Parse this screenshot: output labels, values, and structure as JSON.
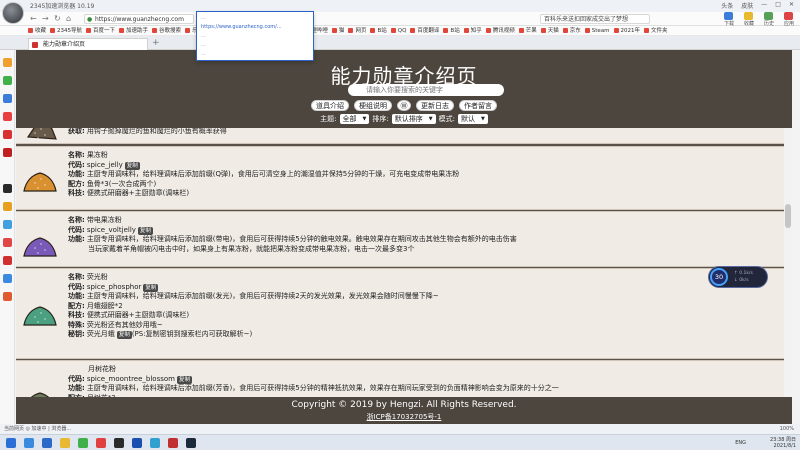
{
  "browser": {
    "title": "2345加速浏览器 10.19",
    "window_controls": [
      "头条",
      "皮肤",
      "—",
      "□",
      "✕"
    ],
    "url": "https://www.guanzhecng.com",
    "search_placeholder": "百科乐来送扣回家成交出了梦想",
    "top_icons": [
      {
        "name": "download-icon",
        "label": "下载",
        "color": "#3b7dd8"
      },
      {
        "name": "favorites-icon",
        "label": "收藏",
        "color": "#e8b830"
      },
      {
        "name": "history-icon",
        "label": "历史",
        "color": "#57a05a"
      },
      {
        "name": "extensions-icon",
        "label": "应用",
        "color": "#d44"
      }
    ],
    "bookmarks": [
      "收藏",
      "2345导航",
      "百度一下",
      "加速助手",
      "谷歌搜索",
      "乐视",
      "网易",
      "Minecraft",
      "正在播放",
      "哔哩哔哩",
      "猫",
      "网页",
      "B站",
      "QQ",
      "百度翻译",
      "B站",
      "知乎",
      "腾讯视频",
      "芒果",
      "天猫",
      "京东",
      "Steam",
      "2021年",
      "文件夹"
    ],
    "tab_title": "能力勋章介绍页",
    "dropdown_lines": [
      "...",
      "https://www.guanzhecng.com/...",
      "...",
      "...",
      "..."
    ]
  },
  "page": {
    "title": "能力勋章介绍页",
    "search_placeholder": "请输入你要搜索的关键字",
    "buttons": [
      "道具介绍",
      "梗组说明",
      "Ⓦ",
      "更新日志",
      "作者留言"
    ],
    "filters": {
      "theme_label": "主题:",
      "theme_value": "全部",
      "sort_label": "排序:",
      "sort_value": "默认排序",
      "mode_label": "模式:",
      "mode_value": "默认"
    },
    "items": [
      {
        "rows": [
          {
            "k": "获取:",
            "v": "用钩子抛掉魔烂的鱼和魔烂的小鱼有概率获得"
          }
        ],
        "art_color": "#6a5a4a"
      },
      {
        "rows": [
          {
            "k": "名称:",
            "v": "果冻粉"
          },
          {
            "k": "代码:",
            "v": "spice_jelly",
            "tag": "复制"
          },
          {
            "k": "功能:",
            "v": "主厨专用调味料，给料理调味后添加前缀(Q弹)，食用后可清空身上的潮湿值并保持5分钟的干燥，可充电变成带电果冻粉"
          },
          {
            "k": "配方:",
            "v": "鱼骨*3(一次合成两个)"
          },
          {
            "k": "科技:",
            "v": "便携式研磨器+主厨勋章(调味栏)"
          }
        ],
        "art_color": "#d99030"
      },
      {
        "rows": [
          {
            "k": "名称:",
            "v": "带电果冻粉"
          },
          {
            "k": "代码:",
            "v": "spice_voltjelly",
            "tag": "复制"
          },
          {
            "k": "功能:",
            "v": "主厨专用调味料，给料理调味后添加前缀(带电)，食用后可获得持续5分钟的触电效果。触电效果存在期间攻击其他生物会有额外的电击伤害"
          },
          {
            "k": "",
            "v": "当玩家戴着羊角帽被闪电击中时，如果身上有果冻粉，就能把果冻粉变成带电果冻粉，电击一次最多变3个"
          }
        ],
        "art_color": "#7a5ab8"
      },
      {
        "rows": [
          {
            "k": "名称:",
            "v": "荧光粉"
          },
          {
            "k": "代码:",
            "v": "spice_phosphor",
            "tag": "复制"
          },
          {
            "k": "功能:",
            "v": "主厨专用调味料，给料理调味后添加前缀(发光)，食用后可获得持续2天的发光效果，发光效果会随时间慢慢下降~"
          },
          {
            "k": "配方:",
            "v": "月蛾翅膀*2"
          },
          {
            "k": "科技:",
            "v": "便携式研磨器+主厨勋章(调味栏)"
          },
          {
            "k": "特殊:",
            "v": "荧光粉还有其他妙用哦~"
          },
          {
            "k": "秘钥:",
            "v": "荧光月蛾",
            "tag": "复制",
            "after": "(PS:复制密钥到搜索栏内可获取解析~)"
          }
        ],
        "art_color": "#4aa080"
      },
      {
        "rows": [
          {
            "k": "",
            "v": "月树花粉"
          },
          {
            "k": "代码:",
            "v": "spice_moontree_blossom",
            "tag": "复制"
          },
          {
            "k": "功能:",
            "v": "主厨专用调味料，给料理调味后添加前缀(芳香)，食用后可获得持续5分钟的精神抵抗效果，效果存在期间玩家受到的负面精神影响会变为原来的十分之一"
          },
          {
            "k": "配方:",
            "v": "月树花*3"
          }
        ],
        "art_color": "#6a7a5a"
      }
    ],
    "footer": {
      "copyright": "Copyright © 2019 by Hengzi. All Rights Reserved.",
      "icp": "浙ICP备17032705号-1"
    }
  },
  "net_widget": {
    "percent": "30",
    "up": "0.1k/s",
    "down": "0k/s"
  },
  "status": {
    "left": "当前网页  ◎  加速中  |  浏览器...",
    "right": "100%"
  },
  "taskbar": {
    "lang": "ENG",
    "time": "23:38 周日",
    "date": "2021/8/1"
  }
}
